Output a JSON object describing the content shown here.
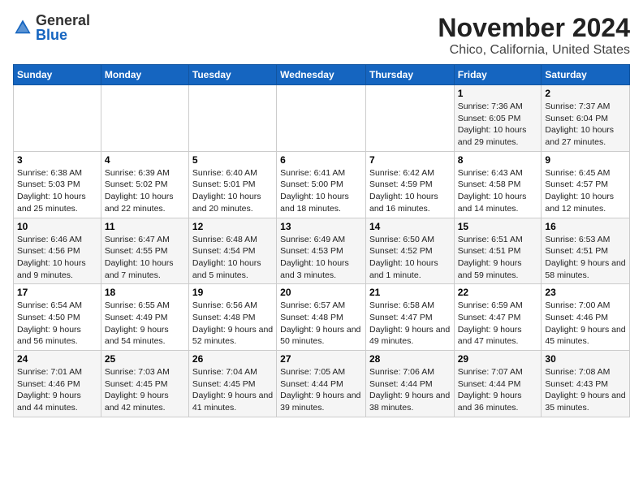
{
  "logo": {
    "general": "General",
    "blue": "Blue"
  },
  "header": {
    "month_year": "November 2024",
    "location": "Chico, California, United States"
  },
  "weekdays": [
    "Sunday",
    "Monday",
    "Tuesday",
    "Wednesday",
    "Thursday",
    "Friday",
    "Saturday"
  ],
  "weeks": [
    [
      {
        "day": "",
        "info": ""
      },
      {
        "day": "",
        "info": ""
      },
      {
        "day": "",
        "info": ""
      },
      {
        "day": "",
        "info": ""
      },
      {
        "day": "",
        "info": ""
      },
      {
        "day": "1",
        "info": "Sunrise: 7:36 AM\nSunset: 6:05 PM\nDaylight: 10 hours and 29 minutes."
      },
      {
        "day": "2",
        "info": "Sunrise: 7:37 AM\nSunset: 6:04 PM\nDaylight: 10 hours and 27 minutes."
      }
    ],
    [
      {
        "day": "3",
        "info": "Sunrise: 6:38 AM\nSunset: 5:03 PM\nDaylight: 10 hours and 25 minutes."
      },
      {
        "day": "4",
        "info": "Sunrise: 6:39 AM\nSunset: 5:02 PM\nDaylight: 10 hours and 22 minutes."
      },
      {
        "day": "5",
        "info": "Sunrise: 6:40 AM\nSunset: 5:01 PM\nDaylight: 10 hours and 20 minutes."
      },
      {
        "day": "6",
        "info": "Sunrise: 6:41 AM\nSunset: 5:00 PM\nDaylight: 10 hours and 18 minutes."
      },
      {
        "day": "7",
        "info": "Sunrise: 6:42 AM\nSunset: 4:59 PM\nDaylight: 10 hours and 16 minutes."
      },
      {
        "day": "8",
        "info": "Sunrise: 6:43 AM\nSunset: 4:58 PM\nDaylight: 10 hours and 14 minutes."
      },
      {
        "day": "9",
        "info": "Sunrise: 6:45 AM\nSunset: 4:57 PM\nDaylight: 10 hours and 12 minutes."
      }
    ],
    [
      {
        "day": "10",
        "info": "Sunrise: 6:46 AM\nSunset: 4:56 PM\nDaylight: 10 hours and 9 minutes."
      },
      {
        "day": "11",
        "info": "Sunrise: 6:47 AM\nSunset: 4:55 PM\nDaylight: 10 hours and 7 minutes."
      },
      {
        "day": "12",
        "info": "Sunrise: 6:48 AM\nSunset: 4:54 PM\nDaylight: 10 hours and 5 minutes."
      },
      {
        "day": "13",
        "info": "Sunrise: 6:49 AM\nSunset: 4:53 PM\nDaylight: 10 hours and 3 minutes."
      },
      {
        "day": "14",
        "info": "Sunrise: 6:50 AM\nSunset: 4:52 PM\nDaylight: 10 hours and 1 minute."
      },
      {
        "day": "15",
        "info": "Sunrise: 6:51 AM\nSunset: 4:51 PM\nDaylight: 9 hours and 59 minutes."
      },
      {
        "day": "16",
        "info": "Sunrise: 6:53 AM\nSunset: 4:51 PM\nDaylight: 9 hours and 58 minutes."
      }
    ],
    [
      {
        "day": "17",
        "info": "Sunrise: 6:54 AM\nSunset: 4:50 PM\nDaylight: 9 hours and 56 minutes."
      },
      {
        "day": "18",
        "info": "Sunrise: 6:55 AM\nSunset: 4:49 PM\nDaylight: 9 hours and 54 minutes."
      },
      {
        "day": "19",
        "info": "Sunrise: 6:56 AM\nSunset: 4:48 PM\nDaylight: 9 hours and 52 minutes."
      },
      {
        "day": "20",
        "info": "Sunrise: 6:57 AM\nSunset: 4:48 PM\nDaylight: 9 hours and 50 minutes."
      },
      {
        "day": "21",
        "info": "Sunrise: 6:58 AM\nSunset: 4:47 PM\nDaylight: 9 hours and 49 minutes."
      },
      {
        "day": "22",
        "info": "Sunrise: 6:59 AM\nSunset: 4:47 PM\nDaylight: 9 hours and 47 minutes."
      },
      {
        "day": "23",
        "info": "Sunrise: 7:00 AM\nSunset: 4:46 PM\nDaylight: 9 hours and 45 minutes."
      }
    ],
    [
      {
        "day": "24",
        "info": "Sunrise: 7:01 AM\nSunset: 4:46 PM\nDaylight: 9 hours and 44 minutes."
      },
      {
        "day": "25",
        "info": "Sunrise: 7:03 AM\nSunset: 4:45 PM\nDaylight: 9 hours and 42 minutes."
      },
      {
        "day": "26",
        "info": "Sunrise: 7:04 AM\nSunset: 4:45 PM\nDaylight: 9 hours and 41 minutes."
      },
      {
        "day": "27",
        "info": "Sunrise: 7:05 AM\nSunset: 4:44 PM\nDaylight: 9 hours and 39 minutes."
      },
      {
        "day": "28",
        "info": "Sunrise: 7:06 AM\nSunset: 4:44 PM\nDaylight: 9 hours and 38 minutes."
      },
      {
        "day": "29",
        "info": "Sunrise: 7:07 AM\nSunset: 4:44 PM\nDaylight: 9 hours and 36 minutes."
      },
      {
        "day": "30",
        "info": "Sunrise: 7:08 AM\nSunset: 4:43 PM\nDaylight: 9 hours and 35 minutes."
      }
    ]
  ]
}
